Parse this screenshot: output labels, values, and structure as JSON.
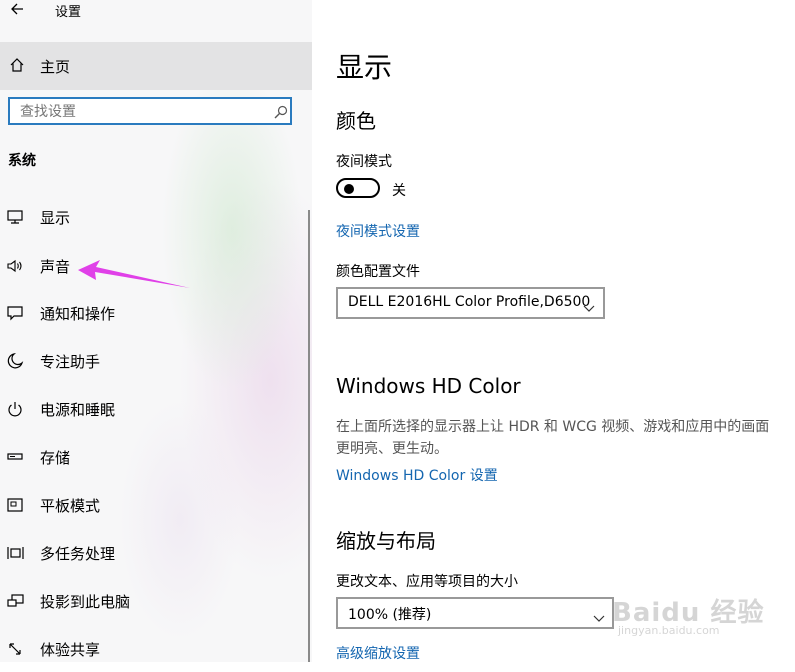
{
  "app": {
    "title": "设置"
  },
  "sidebar": {
    "home_label": "主页",
    "search": {
      "placeholder": "查找设置",
      "value": ""
    },
    "section_title": "系统",
    "items": [
      {
        "label": "显示",
        "icon": "monitor-icon"
      },
      {
        "label": "声音",
        "icon": "speaker-icon"
      },
      {
        "label": "通知和操作",
        "icon": "notification-icon"
      },
      {
        "label": "专注助手",
        "icon": "moon-icon"
      },
      {
        "label": "电源和睡眠",
        "icon": "power-icon"
      },
      {
        "label": "存储",
        "icon": "storage-icon"
      },
      {
        "label": "平板模式",
        "icon": "tablet-icon"
      },
      {
        "label": "多任务处理",
        "icon": "multitask-icon"
      },
      {
        "label": "投影到此电脑",
        "icon": "project-icon"
      },
      {
        "label": "体验共享",
        "icon": "share-icon"
      }
    ]
  },
  "main": {
    "page_title": "显示",
    "color": {
      "heading": "颜色",
      "night_mode_label": "夜间模式",
      "night_mode_state": "关",
      "night_mode_settings_link": "夜间模式设置",
      "color_profile_label": "颜色配置文件",
      "color_profile_value": "DELL E2016HL Color Profile,D6500"
    },
    "hdr": {
      "heading": "Windows HD Color",
      "description": "在上面所选择的显示器上让 HDR 和 WCG 视频、游戏和应用中的画面更明亮、更生动。",
      "settings_link": "Windows HD Color 设置"
    },
    "scale": {
      "heading": "缩放与布局",
      "size_label": "更改文本、应用等项目的大小",
      "size_value": "100% (推荐)",
      "advanced_link": "高级缩放设置"
    }
  },
  "watermark": {
    "main": "Baidu 经验",
    "sub": "jingyan.baidu.com"
  },
  "colors": {
    "accent": "#1466b0",
    "search_border": "#2a7bbf",
    "arrow": "#e040e8"
  }
}
